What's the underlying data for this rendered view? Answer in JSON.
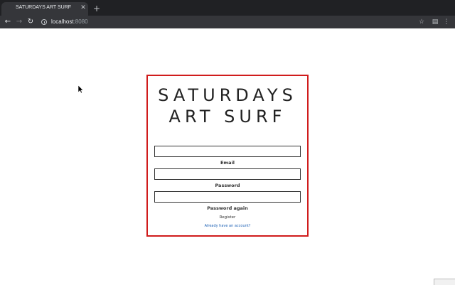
{
  "browser": {
    "tab_title": "SATURDAYS ART SURF",
    "tab_close": "✕",
    "new_tab": "+",
    "url_host": "localhost",
    "url_port": ":8080",
    "icons": {
      "back": "back-arrow-icon",
      "forward": "forward-arrow-icon",
      "reload": "reload-icon",
      "star": "star-icon",
      "extension": "extension-icon",
      "menu": "kebab-menu-icon"
    }
  },
  "page": {
    "brand": "SATURDAYS ART SURF",
    "fields": [
      {
        "label": "Email",
        "value": ""
      },
      {
        "label": "Password",
        "value": ""
      },
      {
        "label": "Password again",
        "value": ""
      }
    ],
    "register_label": "Register",
    "login_link": "Already have an account?"
  },
  "colors": {
    "card_border": "#d01c1c",
    "link": "#1a5fb4",
    "chrome_dark": "#202124",
    "chrome_toolbar": "#35363a"
  }
}
